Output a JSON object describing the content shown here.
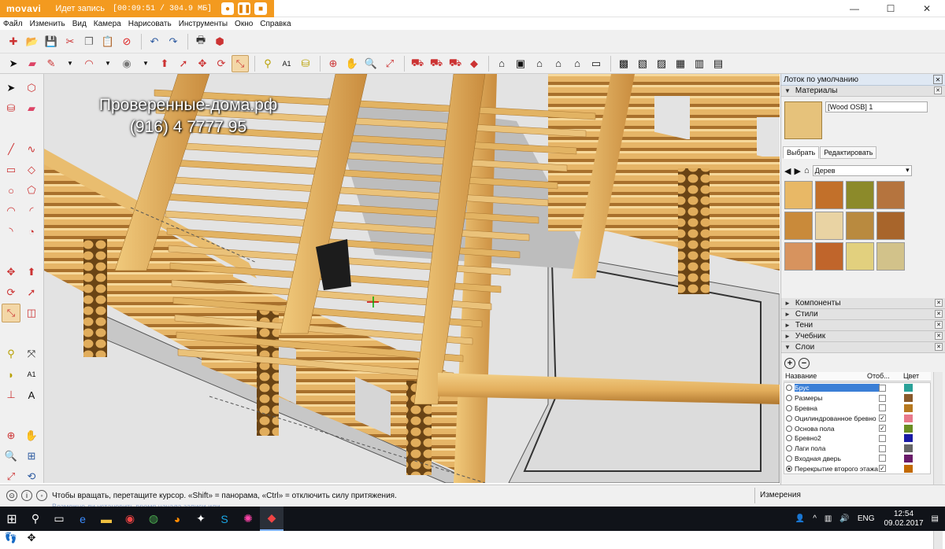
{
  "recorder": {
    "logo": "movavi",
    "status": "Идет запись",
    "timer": "[00:09:51 / 304.9 МБ]",
    "record_icon": "record-icon",
    "pause_icon": "pause-icon",
    "stop_icon": "stop-icon",
    "accent": "#f39a1f"
  },
  "window_controls": {
    "minimize": "—",
    "maximize": "☐",
    "close": "✕"
  },
  "menu": [
    "Файл",
    "Изменить",
    "Вид",
    "Камера",
    "Нарисовать",
    "Инструменты",
    "Окно",
    "Справка"
  ],
  "viewport": {
    "watermark_line1": "Проверенные-дома.рф",
    "watermark_line2": "(916) 4 7777 95",
    "log_color": "#e7b868",
    "log_shadow": "#b57f35",
    "floor_color": "#d9d9d9"
  },
  "tray": {
    "title": "Лоток по умолчанию",
    "materials": {
      "section_label": "Материалы",
      "current_name": "[Wood OSB] 1",
      "tab_select": "Выбрать",
      "tab_edit": "Редактировать",
      "collection": "Дерев",
      "swatches": [
        "#e8b866",
        "#c2702a",
        "#8c8a2a",
        "#b5743e",
        "#c98a3a",
        "#e9d3a3",
        "#b98a3f",
        "#a8652b",
        "#d7935e",
        "#c0652b",
        "#e2d07e",
        "#d2c28a"
      ]
    },
    "sections": [
      "Компоненты",
      "Стили",
      "Тени",
      "Учебник"
    ],
    "layers": {
      "section_label": "Слои",
      "col_name": "Название",
      "col_visible": "Отоб...",
      "col_color": "Цвет",
      "rows": [
        {
          "name": "Брус",
          "visible": false,
          "color": "#2aa198",
          "selected": true,
          "active": false
        },
        {
          "name": "Размеры",
          "visible": false,
          "color": "#8a5a2b",
          "selected": false,
          "active": false
        },
        {
          "name": "Бревна",
          "visible": false,
          "color": "#b7791f",
          "selected": false,
          "active": false
        },
        {
          "name": "Оцилиндрованное бревно",
          "visible": true,
          "color": "#e8788a",
          "selected": false,
          "active": false
        },
        {
          "name": "Основа пола",
          "visible": true,
          "color": "#6b8e23",
          "selected": false,
          "active": false
        },
        {
          "name": "Бревно2",
          "visible": false,
          "color": "#1a1aa6",
          "selected": false,
          "active": false
        },
        {
          "name": "Лаги пола",
          "visible": false,
          "color": "#666666",
          "selected": false,
          "active": false
        },
        {
          "name": "Входная дверь",
          "visible": false,
          "color": "#6a1b6a",
          "selected": false,
          "active": false
        },
        {
          "name": "Перекрытие второго этажа",
          "visible": true,
          "color": "#c26a00",
          "selected": false,
          "active": true
        }
      ]
    }
  },
  "statusbar": {
    "message": "Чтобы вращать, перетащите курсор. «Shift» = панорама, «Ctrl» = отключить силу притяжения.",
    "measurements_label": "Измерения",
    "ghost": "Возможно ли установить время начала записи или..."
  },
  "taskbar": {
    "language": "ENG",
    "time": "12:54",
    "date": "09.02.2017"
  }
}
